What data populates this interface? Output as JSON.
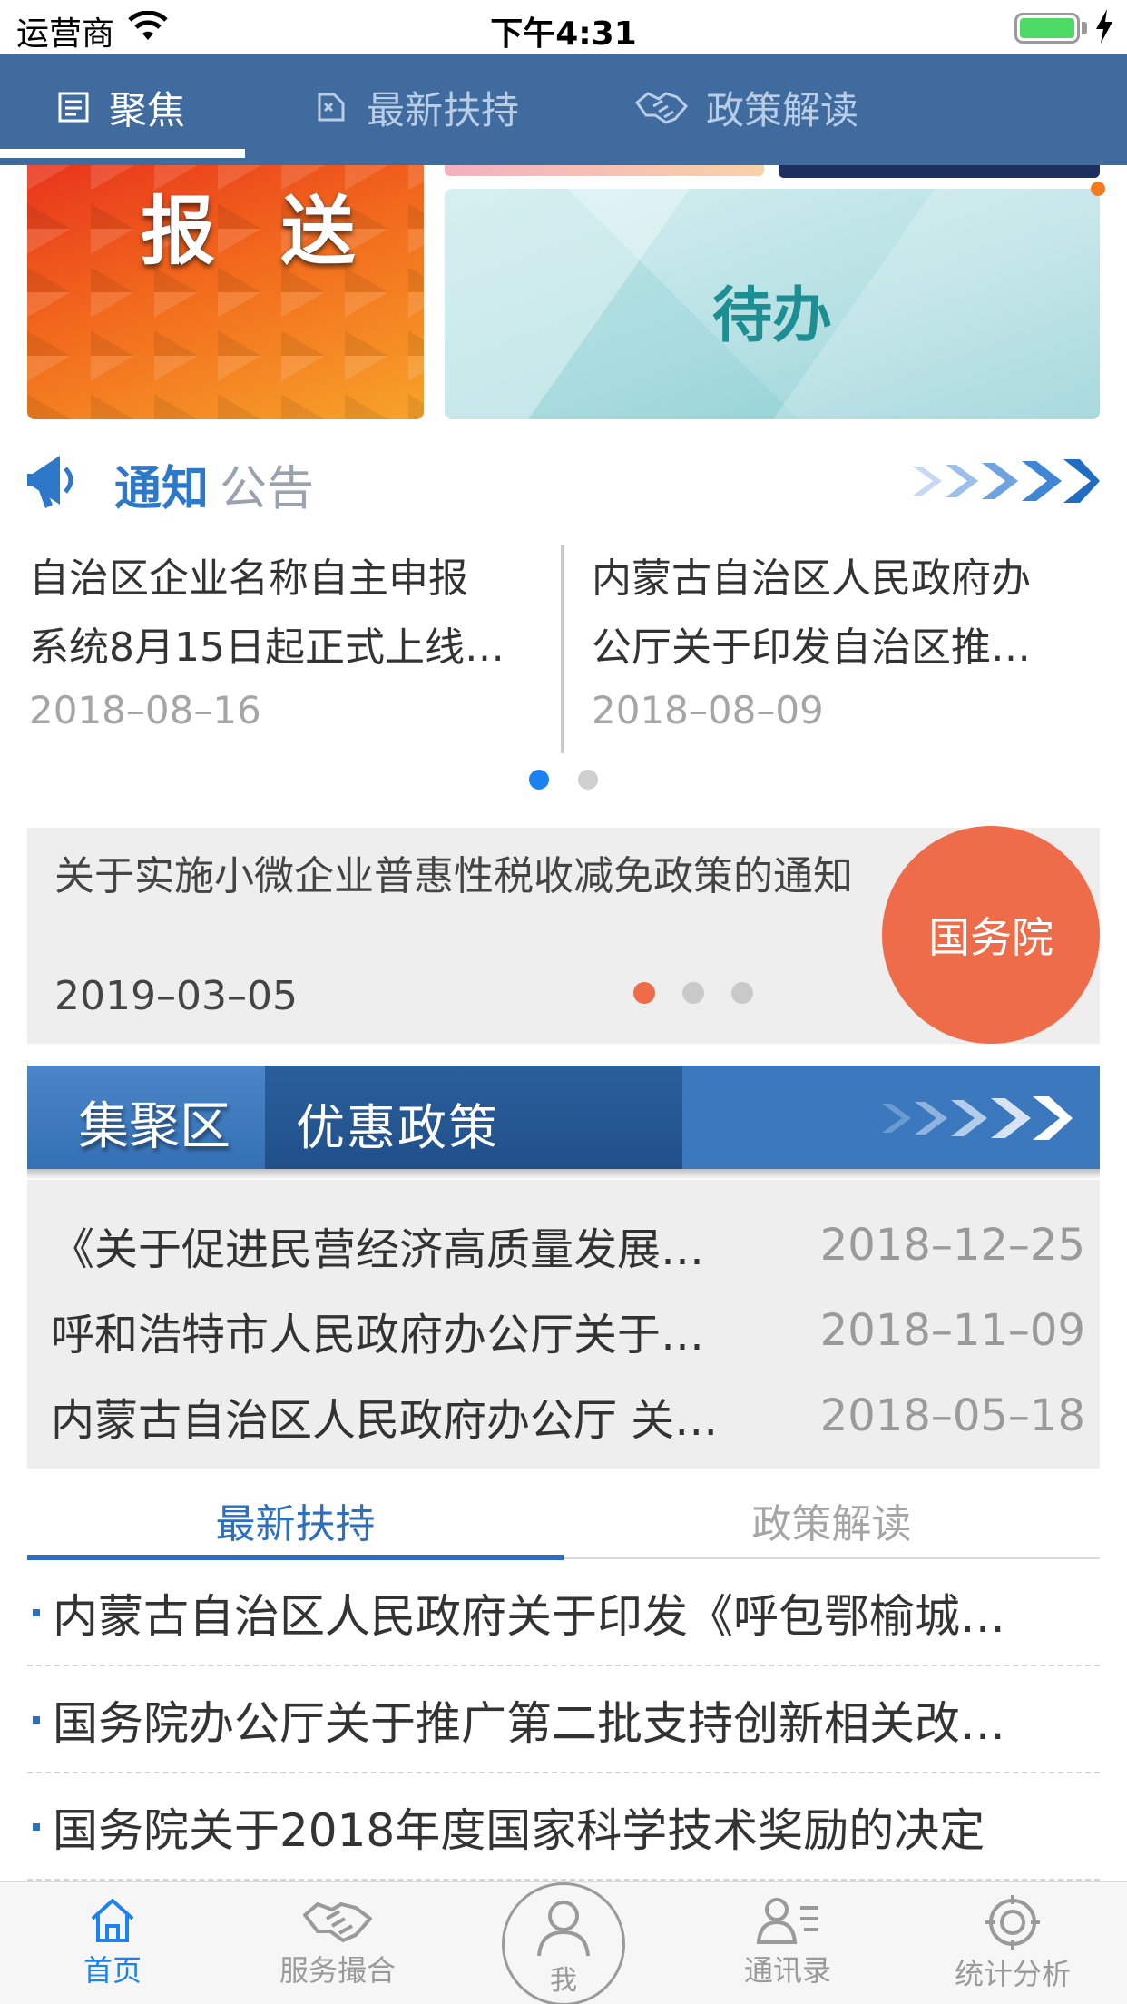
{
  "status_bar": {
    "carrier": "运营商",
    "time": "下午4:31"
  },
  "top_tabs": [
    {
      "label": "聚焦",
      "icon": "document-icon",
      "active": true
    },
    {
      "label": "最新扶持",
      "icon": "tag-icon",
      "active": false
    },
    {
      "label": "政策解读",
      "icon": "handshake-icon",
      "active": false
    }
  ],
  "tiles": {
    "report": "报 送",
    "todo": "待办"
  },
  "notice": {
    "title_a": "通知",
    "title_b": "公告",
    "items": [
      {
        "line1": "自治区企业名称自主申报",
        "line2": "系统8月15日起正式上线…",
        "date": "2018–08–16"
      },
      {
        "line1": "内蒙古自治区人民政府办",
        "line2": "公厅关于印发自治区推…",
        "date": "2018–08–09"
      }
    ],
    "pages": 2,
    "active_page": 1
  },
  "council": {
    "title": "关于实施小微企业普惠性税收减免政策的通知",
    "date": "2019–03–05",
    "badge": "国务院",
    "pages": 3,
    "active_page": 1
  },
  "cluster": {
    "left_label": "集聚区",
    "mid_label": "优惠政策",
    "items": [
      {
        "title": "《关于促进民营经济高质量发展…",
        "date": "2018–12–25"
      },
      {
        "title": "呼和浩特市人民政府办公厅关于…",
        "date": "2018–11–09"
      },
      {
        "title": "内蒙古自治区人民政府办公厅 关…",
        "date": "2018–05–18"
      }
    ]
  },
  "news_tabs": [
    {
      "label": "最新扶持",
      "active": true
    },
    {
      "label": "政策解读",
      "active": false
    }
  ],
  "news_items": [
    "内蒙古自治区人民政府关于印发《呼包鄂榆城…",
    "国务院办公厅关于推广第二批支持创新相关改…",
    "国务院关于2018年度国家科学技术奖励的决定"
  ],
  "bottom_tabs": [
    {
      "label": "首页",
      "icon": "home-icon",
      "active": true
    },
    {
      "label": "服务撮合",
      "icon": "handshake-icon",
      "active": false
    },
    {
      "label": "我",
      "icon": "user-icon",
      "active": false
    },
    {
      "label": "通讯录",
      "icon": "contacts-icon",
      "active": false
    },
    {
      "label": "统计分析",
      "icon": "target-icon",
      "active": false
    }
  ],
  "colors": {
    "header_blue": "#3f6b9f",
    "accent_blue": "#1b82f0",
    "policy_blue": "#3b78bd",
    "council_orange": "#ef6c4a"
  }
}
